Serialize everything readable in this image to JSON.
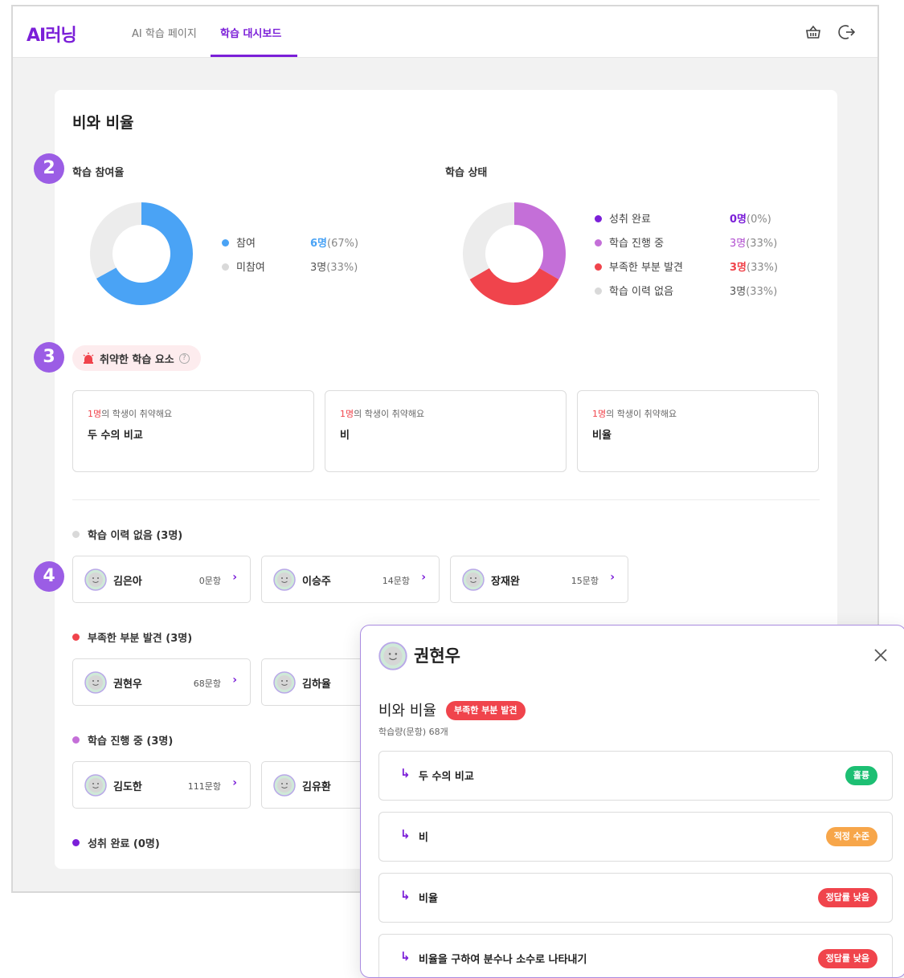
{
  "header": {
    "logo": "AI러닝",
    "tabs": [
      {
        "label": "AI 학습 페이지"
      },
      {
        "label": "학습 대시보드"
      }
    ]
  },
  "main": {
    "title": "비와 비율",
    "participation": {
      "title": "학습 참여율",
      "legend": [
        {
          "label": "참여",
          "count": "6명",
          "pct": "(67%)",
          "color": "#4aa3f5",
          "value": 67
        },
        {
          "label": "미참여",
          "count": "3명",
          "pct": "(33%)",
          "color": "#e3e3e3",
          "value": 33
        }
      ]
    },
    "status": {
      "title": "학습 상태",
      "legend": [
        {
          "label": "성취 완료",
          "count": "0명",
          "pct": "(0%)",
          "color": "#7b1fd8",
          "value": 0
        },
        {
          "label": "학습 진행 중",
          "count": "3명",
          "pct": "(33%)",
          "color": "#c46fd8",
          "value": 33
        },
        {
          "label": "부족한 부분 발견",
          "count": "3명",
          "pct": "(33%)",
          "color": "#f0444c",
          "value": 33
        },
        {
          "label": "학습 이력 없음",
          "count": "3명",
          "pct": "(33%)",
          "color": "#e3e3e3",
          "value": 33
        }
      ]
    },
    "weak": {
      "title": "취약한 학습 요소",
      "cards": [
        {
          "count": "1명",
          "suffix": "의 학생이 취약해요",
          "name": "두 수의 비교"
        },
        {
          "count": "1명",
          "suffix": "의 학생이 취약해요",
          "name": "비"
        },
        {
          "count": "1명",
          "suffix": "의 학생이 취약해요",
          "name": "비율"
        }
      ]
    },
    "groups": {
      "none": {
        "title": "학습 이력 없음 (3명)",
        "color": "#d9d9d9",
        "students": [
          {
            "name": "김은아",
            "count": "0문항"
          },
          {
            "name": "이승주",
            "count": "14문항"
          },
          {
            "name": "장재완",
            "count": "15문항"
          }
        ]
      },
      "lacking": {
        "title": "부족한 부분 발견 (3명)",
        "color": "#f0444c",
        "students": [
          {
            "name": "권현우",
            "count": "68문항"
          },
          {
            "name": "김하율",
            "count": ""
          }
        ]
      },
      "progress": {
        "title": "학습 진행 중 (3명)",
        "color": "#c46fd8",
        "students": [
          {
            "name": "김도한",
            "count": "111문항"
          },
          {
            "name": "김유환",
            "count": ""
          }
        ]
      },
      "done": {
        "title": "성취 완료 (0명)",
        "color": "#7b1fd8"
      }
    },
    "markers": [
      "2",
      "3",
      "4"
    ]
  },
  "panel": {
    "student": "권현우",
    "topic": "비와 비율",
    "tag": "부족한 부분 발견",
    "meta": "학습량(문항) 68개",
    "items": [
      {
        "label": "두 수의 비교",
        "status": "훌륭",
        "color": "#1dbf73"
      },
      {
        "label": "비",
        "status": "적정 수준",
        "color": "#f7a64a"
      },
      {
        "label": "비율",
        "status": "정답률 낮음",
        "color": "#f0444c"
      },
      {
        "label": "비율을 구하여 분수나 소수로 나타내기",
        "status": "정답률 낮음",
        "color": "#f0444c"
      }
    ]
  }
}
